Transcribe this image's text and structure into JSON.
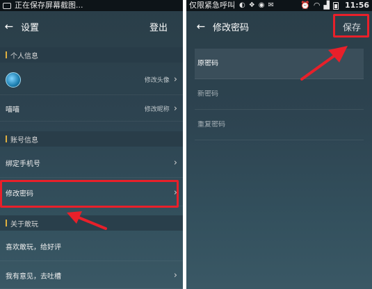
{
  "left": {
    "status": {
      "text": "正在保存屏幕截图..."
    },
    "titlebar": {
      "title": "设置",
      "action": "登出"
    },
    "sections": [
      {
        "title": "个人信息"
      },
      {
        "title": "账号信息"
      },
      {
        "title": "关于敢玩"
      }
    ],
    "rows": {
      "avatar_action": "修改头像",
      "nickname": "喵喵",
      "nickname_action": "修改昵称",
      "bind_phone": "绑定手机号",
      "change_password": "修改密码",
      "rate": "喜欢敢玩，给好评",
      "feedback": "我有意见，去吐槽"
    }
  },
  "right": {
    "status": {
      "carrier": "仅限紧急呼叫",
      "time": "11:56"
    },
    "titlebar": {
      "title": "修改密码",
      "action": "保存"
    },
    "fields": {
      "old_password": "原密码",
      "new_password": "新密码",
      "repeat_password": "重复密码"
    }
  },
  "colors": {
    "highlight": "#e8202a",
    "section_marker": "#e0b040"
  }
}
